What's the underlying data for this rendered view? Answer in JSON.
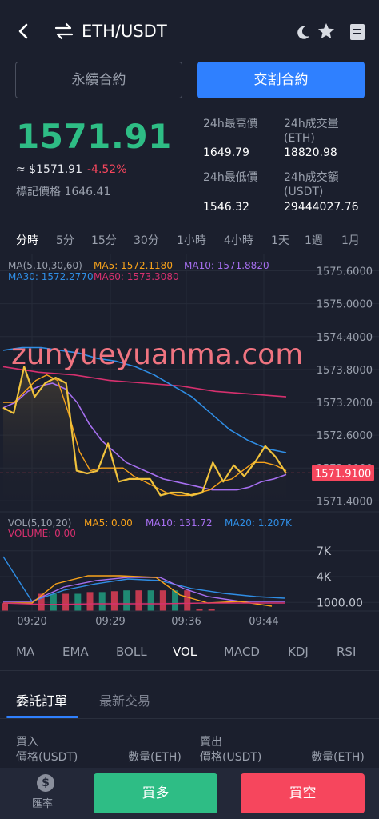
{
  "header": {
    "pair": "ETH/USDT"
  },
  "tabs": {
    "perpetual": "永續合約",
    "delivery": "交割合約"
  },
  "price": {
    "last": "1571.91",
    "usd_prefix": "≈ $1571.91",
    "change": "-4.52%",
    "mark_label": "標記價格",
    "mark_value": "1646.41"
  },
  "stats": {
    "high_label": "24h最高價",
    "high_value": "1649.79",
    "vol_label_1": "24h成交量",
    "vol_label_2": "(ETH)",
    "vol_value": "18820.98",
    "low_label": "24h最低價",
    "low_value": "1546.32",
    "amt_label_1": "24h成交額",
    "amt_label_2": "(USDT)",
    "amt_value": "29444027.76"
  },
  "timeframes": [
    "分時",
    "5分",
    "15分",
    "30分",
    "1小時",
    "4小時",
    "1天",
    "1週",
    "1月"
  ],
  "timeframe_active": "分時",
  "chart_legend": {
    "ma_title": "MA(5,10,30,60)",
    "ma5": "MA5: 1572.1180",
    "ma10": "MA10: 1571.8820",
    "ma30": "MA30: 1572.2770",
    "ma60": "MA60: 1573.3080",
    "vol_title": "VOL(5,10,20)",
    "vol_ma5": "MA5: 0.00",
    "vol_ma10": "MA10: 131.72",
    "vol_ma20": "MA20: 1.207K",
    "volume": "VOLUME: 0.00"
  },
  "watermark": "zunyueyuanma.com",
  "colors": {
    "up": "#2ebd85",
    "down": "#f6465d",
    "accent": "#2f80ff",
    "price_line": "#f0c23c",
    "ma5": "#f7a21b",
    "ma10": "#a66ff0",
    "ma30": "#2f8de4",
    "ma60": "#d6306e"
  },
  "chart_data": {
    "type": "line",
    "y_ticks": [
      "1575.6000",
      "1575.0000",
      "1574.4000",
      "1573.8000",
      "1573.2000",
      "1572.6000",
      "1572.0000",
      "1571.4000"
    ],
    "y_range": [
      1571.2,
      1575.9
    ],
    "current_price_label": "1571.9100",
    "x_ticks": [
      "09:20",
      "09:29",
      "09:36",
      "09:44"
    ],
    "price": [
      1573.1,
      1573.0,
      1573.85,
      1573.3,
      1573.55,
      1573.65,
      1573.55,
      1571.95,
      1571.9,
      1571.95,
      1572.45,
      1571.75,
      1571.8,
      1571.8,
      1571.8,
      1571.5,
      1571.55,
      1571.55,
      1571.5,
      1571.55,
      1572.1,
      1571.75,
      1572.05,
      1571.85,
      1572.1,
      1572.4,
      1572.2,
      1571.9
    ],
    "ma5": [
      1573.2,
      1573.2,
      1573.4,
      1573.6,
      1573.7,
      1573.6,
      1573.0,
      1572.3,
      1571.95,
      1572.0,
      1572.0,
      1572.0,
      1571.85,
      1571.75,
      1571.65,
      1571.55,
      1571.5,
      1571.5,
      1571.55,
      1571.6,
      1571.75,
      1571.8,
      1571.95,
      1572.1,
      1572.1,
      1572.05,
      1571.95
    ],
    "ma10": [
      1573.1,
      1573.2,
      1573.4,
      1573.5,
      1573.55,
      1573.45,
      1573.2,
      1572.8,
      1572.5,
      1572.3,
      1572.1,
      1572.0,
      1571.9,
      1571.8,
      1571.75,
      1571.7,
      1571.65,
      1571.6,
      1571.6,
      1571.6,
      1571.65,
      1571.75,
      1571.8,
      1571.88
    ],
    "ma30": [
      1574.15,
      1574.2,
      1574.2,
      1574.15,
      1574.1,
      1574.0,
      1573.95,
      1573.85,
      1573.7,
      1573.5,
      1573.3,
      1573.0,
      1572.7,
      1572.5,
      1572.35,
      1572.28
    ],
    "ma60": [
      1573.85,
      1573.75,
      1573.7,
      1573.6,
      1573.55,
      1573.5,
      1573.4,
      1573.35,
      1573.3
    ],
    "volume_y_ticks": [
      "7K",
      "4K",
      "1000.00"
    ],
    "volume": [
      900,
      0,
      0,
      2000,
      2000,
      2000,
      2000,
      2200,
      2200,
      2300,
      2400,
      2400,
      2400,
      2400,
      2400,
      2400,
      200,
      200,
      0,
      0,
      0,
      0,
      0,
      0
    ],
    "volume_colors": [
      "down",
      "down",
      "down",
      "down",
      "up",
      "down",
      "up",
      "down",
      "up",
      "down",
      "up",
      "down",
      "up",
      "down",
      "up",
      "down",
      "down",
      "down",
      "down",
      "down",
      "down",
      "down",
      "down",
      "down"
    ]
  },
  "indicators": [
    "MA",
    "EMA",
    "BOLL",
    "VOL",
    "MACD",
    "KDJ",
    "RSI"
  ],
  "indicator_active": "VOL",
  "orderbook": {
    "tab_orders": "委託訂單",
    "tab_trades": "最新交易",
    "buy_label": "買入",
    "buy_price": "價格(USDT)",
    "buy_qty": "數量(ETH)",
    "sell_label": "賣出",
    "sell_price": "價格(USDT)",
    "sell_qty": "數量(ETH)"
  },
  "bottom": {
    "rate_icon": "$",
    "rate_label": "匯率",
    "buy_long": "買多",
    "buy_short": "買空"
  }
}
